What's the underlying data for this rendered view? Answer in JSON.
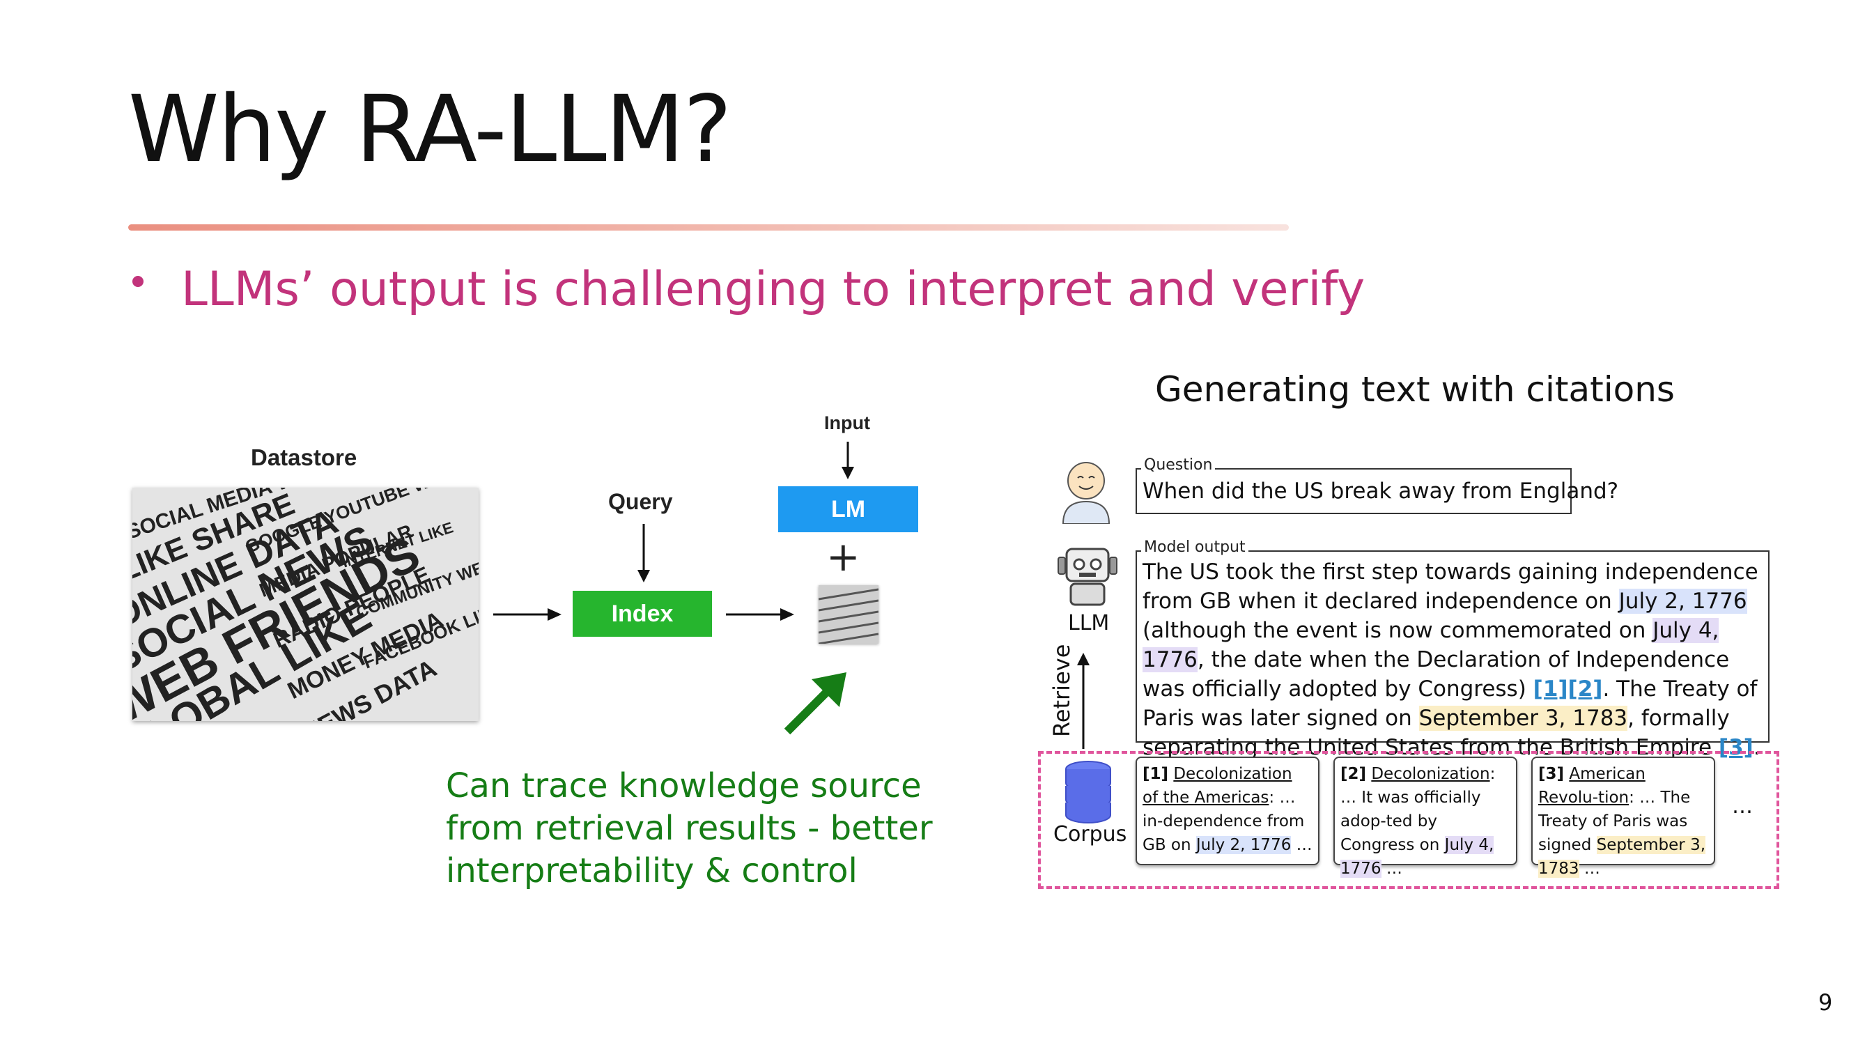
{
  "slide": {
    "title": "Why RA-LLM?",
    "bullet": "LLMs’ output is challenging to interpret and verify",
    "page_number": "9"
  },
  "left_diagram": {
    "datastore_label": "Datastore",
    "query_label": "Query",
    "index_label": "Index",
    "input_label": "Input",
    "lm_label": "LM",
    "plus": "+",
    "note": "Can trace knowledge source\nfrom retrieval results - better\ninterpretability & control",
    "note_color": "#167d16",
    "index_color": "#26b52e",
    "lm_color": "#1e9af1"
  },
  "right_panel": {
    "title": "Generating text with citations",
    "question_caption": "Question",
    "question": "When did the US break away from England?",
    "model_output_caption": "Model output",
    "model_output_parts": {
      "p1": "The US took the first step towards gaining independence from GB when it declared independence on ",
      "d1": "July 2, 1776",
      "p2": " (although the event is now commemorated on ",
      "d2": "July 4, 1776",
      "p3": ", the date when the Declaration of Independence was officially adopted by Congress) ",
      "c12": "[1][2]",
      "p4": ". The Treaty of Paris was later signed on ",
      "d3": "September 3, 1783",
      "p5": ", formally separating the United States from the British Empire ",
      "c3": "[3]",
      "p6": "."
    },
    "llm_label": "LLM",
    "retrieve_label": "Retrieve",
    "corpus_label": "Corpus",
    "documents": [
      {
        "num": "[1]",
        "title": "Decolonization of the Americas",
        "text": ": … in-dependence from GB on ",
        "date": "July 2, 1776",
        "tail": " …"
      },
      {
        "num": "[2]",
        "title": "Decolonization",
        "text": ": … It was officially adop-ted by Congress on ",
        "date": "July 4, 1776",
        "tail": " …"
      },
      {
        "num": "[3]",
        "title": "American Revolu-tion",
        "text": ": … The Treaty of Paris was signed ",
        "date": "September 3, 1783",
        "tail": " …"
      }
    ],
    "more": "…"
  }
}
